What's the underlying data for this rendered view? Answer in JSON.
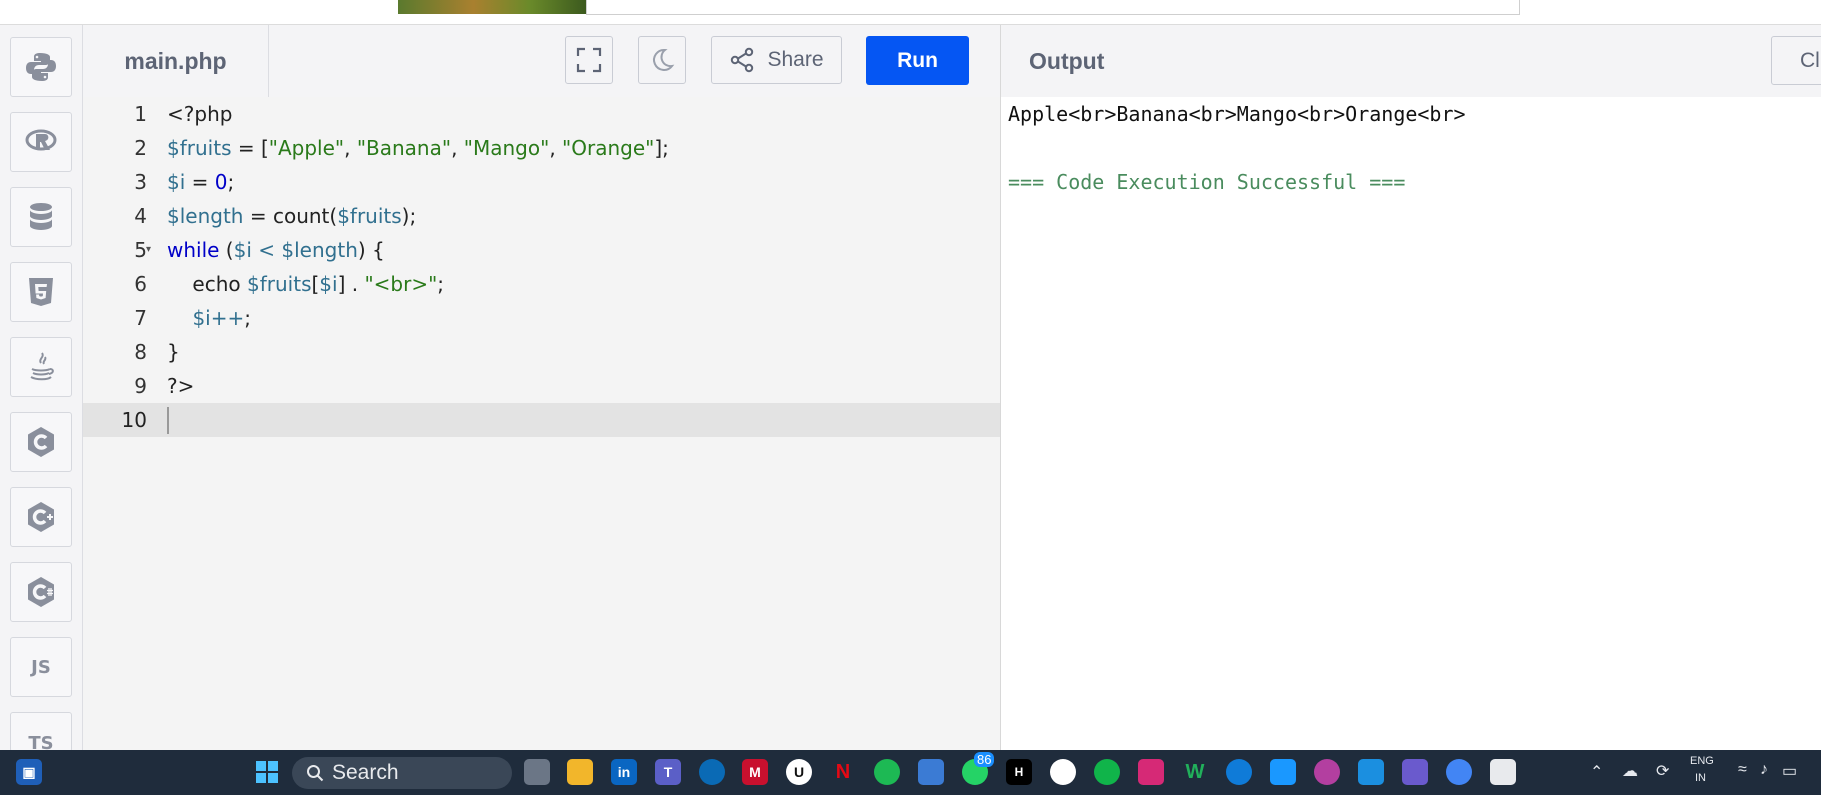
{
  "editor": {
    "file_tab": "main.php",
    "share_label": "Share",
    "run_label": "Run",
    "lines": [
      {
        "num": "1"
      },
      {
        "num": "2"
      },
      {
        "num": "3"
      },
      {
        "num": "4"
      },
      {
        "num": "5"
      },
      {
        "num": "6"
      },
      {
        "num": "7"
      },
      {
        "num": "8"
      },
      {
        "num": "9"
      },
      {
        "num": "10"
      }
    ],
    "code": {
      "l1": "<?php",
      "l2_var": "$fruits",
      "l2_op": " = [",
      "l2_s1": "\"Apple\"",
      "l2_c1": ", ",
      "l2_s2": "\"Banana\"",
      "l2_c2": ", ",
      "l2_s3": "\"Mango\"",
      "l2_c3": ", ",
      "l2_s4": "\"Orange\"",
      "l2_end": "];",
      "l3_var": "$i",
      "l3_op": " = ",
      "l3_num": "0",
      "l3_end": ";",
      "l4_var": "$length",
      "l4_op": " = count(",
      "l4_arg": "$fruits",
      "l4_end": ");",
      "l5_kw": "while",
      "l5_open": " (",
      "l5_v1": "$i",
      "l5_op": " < ",
      "l5_v2": "$length",
      "l5_end": ") {",
      "l6_indent": "    echo ",
      "l6_var": "$fruits",
      "l6_b1": "[",
      "l6_idx": "$i",
      "l6_b2": "] . ",
      "l6_str": "\"<br>\"",
      "l6_end": ";",
      "l7_indent": "    ",
      "l7_var": "$i++",
      "l7_end": ";",
      "l8": "}",
      "l9": "?>"
    }
  },
  "output": {
    "title": "Output",
    "clear_label": "Cl",
    "line1": "Apple<br>Banana<br>Mango<br>Orange<br>",
    "line2": "=== Code Execution Successful ==="
  },
  "sidebar": {
    "items": [
      "python-icon",
      "r-icon",
      "database-icon",
      "html5-icon",
      "java-icon",
      "c-icon",
      "cpp-icon",
      "csharp-icon",
      "JS",
      "TS"
    ]
  },
  "taskbar": {
    "search_label": "Search",
    "whatsapp_badge": "86",
    "lang_line1": "ENG",
    "lang_line2": "IN"
  },
  "colors": {
    "run_button": "#0556f3",
    "output_success": "#4a8c5e",
    "taskbar": "#1f2c3c"
  }
}
